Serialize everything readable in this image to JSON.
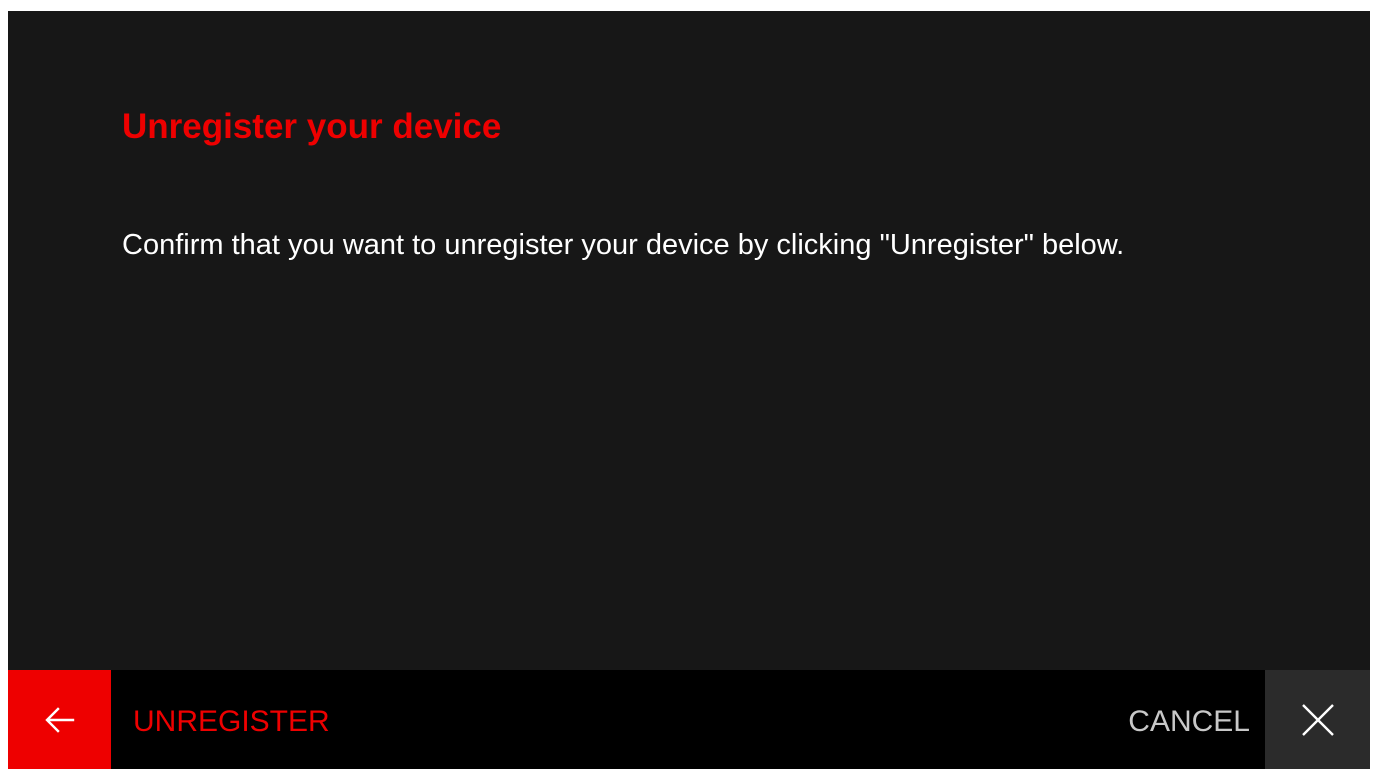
{
  "dialog": {
    "title": "Unregister your device",
    "message": "Confirm that you want to unregister your device by clicking \"Unregister\" below."
  },
  "bottom_bar": {
    "back_icon": "arrow-left-icon",
    "unregister_label": "UNREGISTER",
    "cancel_label": "CANCEL",
    "close_icon": "close-icon"
  },
  "colors": {
    "background": "#171717",
    "bar_background": "#000000",
    "accent": "#ee0000",
    "back_button_bg": "#ee0000",
    "close_button_bg": "#2b2b2b",
    "text_primary": "#ffffff",
    "text_secondary": "#c8c8c8"
  }
}
